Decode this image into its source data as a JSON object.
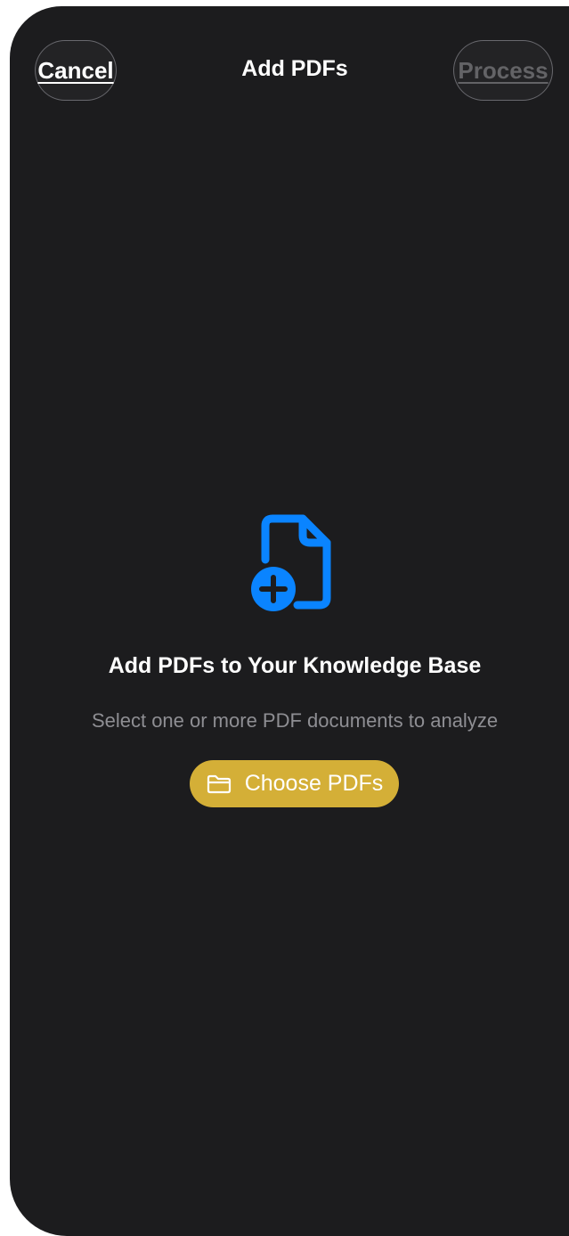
{
  "nav": {
    "cancel_label": "Cancel",
    "title": "Add PDFs",
    "process_label": "Process"
  },
  "empty_state": {
    "icon": "document-add-icon",
    "title": "Add PDFs to Your Knowledge Base",
    "subtitle": "Select one or more PDF documents to analyze",
    "button_label": "Choose PDFs",
    "button_icon": "folder-icon"
  },
  "colors": {
    "background": "#1c1c1e",
    "accent_blue": "#0a84ff",
    "button_gold": "#d4af37",
    "disabled_text": "#636366",
    "secondary_text": "#8e8e93"
  }
}
